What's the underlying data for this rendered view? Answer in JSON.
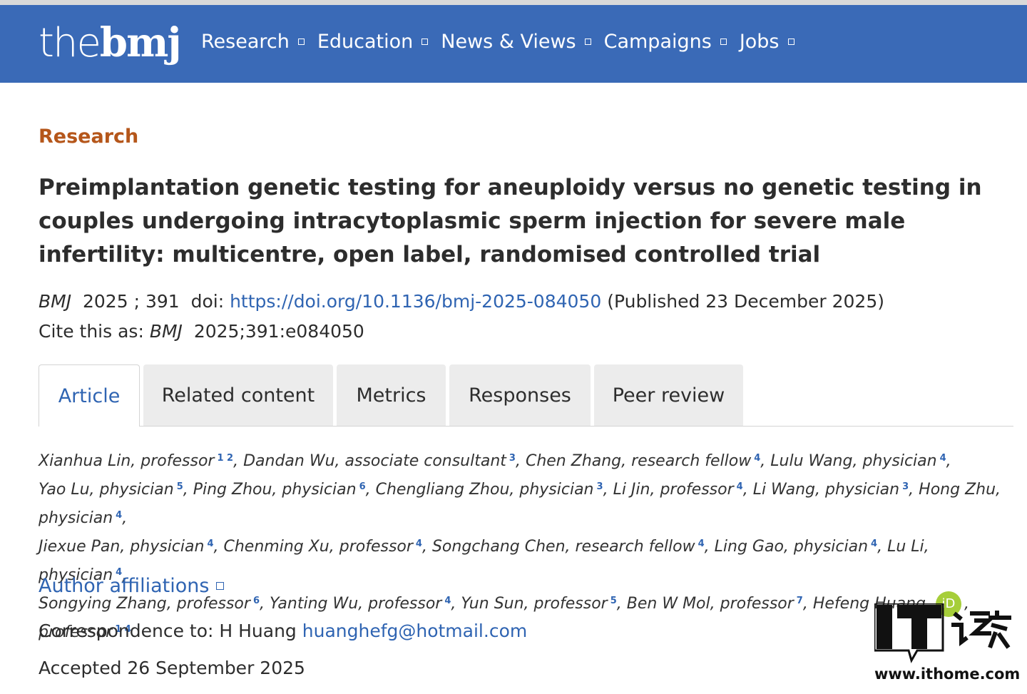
{
  "logo": {
    "thin": "the",
    "bold": "bmj"
  },
  "nav": {
    "items": [
      {
        "label": "Research"
      },
      {
        "label": "Education"
      },
      {
        "label": "News & Views"
      },
      {
        "label": "Campaigns"
      },
      {
        "label": "Jobs"
      }
    ]
  },
  "article": {
    "section": "Research",
    "title": "Preimplantation genetic testing for aneuploidy versus no genetic testing in couples undergoing intracytoplasmic sperm injection for severe male infertility: multicentre, open label, randomised controlled trial",
    "journal": "BMJ",
    "year_vol": "2025 ; 391",
    "doi_prefix": "doi:",
    "doi": "https://doi.org/10.1136/bmj-2025-084050",
    "published": "(Published 23 December 2025)",
    "cite_prefix": "Cite this as:",
    "cite_rest": "2025;391:e084050"
  },
  "tabs": [
    {
      "label": "Article",
      "active": true
    },
    {
      "label": "Related content"
    },
    {
      "label": "Metrics"
    },
    {
      "label": "Responses"
    },
    {
      "label": "Peer review"
    }
  ],
  "authors": [
    {
      "name": "Xianhua Lin, professor",
      "aff": "1  2"
    },
    {
      "name": "Dandan Wu, associate consultant",
      "aff": "3"
    },
    {
      "name": "Chen Zhang, research fellow",
      "aff": "4"
    },
    {
      "name": "Lulu Wang, physician",
      "aff": "4"
    },
    {
      "name": "Yao Lu, physician",
      "aff": "5"
    },
    {
      "name": "Ping Zhou, physician",
      "aff": "6"
    },
    {
      "name": "Chengliang Zhou, physician",
      "aff": "3"
    },
    {
      "name": "Li Jin, professor",
      "aff": "4"
    },
    {
      "name": "Li Wang, physician",
      "aff": "3"
    },
    {
      "name": "Hong Zhu, physician",
      "aff": "4"
    },
    {
      "name": "Jiexue Pan, physician",
      "aff": "4"
    },
    {
      "name": "Chenming Xu, professor",
      "aff": "4"
    },
    {
      "name": "Songchang Chen, research fellow",
      "aff": "4"
    },
    {
      "name": "Ling Gao, physician",
      "aff": "4"
    },
    {
      "name": "Lu Li, physician",
      "aff": "4"
    },
    {
      "name": "Songying Zhang, professor",
      "aff": "6"
    },
    {
      "name": "Yanting Wu, professor",
      "aff": "4"
    },
    {
      "name": "Yun Sun, professor",
      "aff": "5"
    },
    {
      "name": "Ben W Mol, professor",
      "aff": "7"
    },
    {
      "name": "Hefeng Huang",
      "orcid": "iD",
      "suffix": ", professor",
      "aff": "1  4"
    }
  ],
  "affiliations_label": "Author affiliations",
  "correspondence": {
    "prefix": "Correspondence to: H Huang",
    "email": "huanghefg@hotmail.com"
  },
  "accepted": "Accepted 26 September 2025",
  "watermark": {
    "text": "www.ithome.com",
    "logo_letters": "IT",
    "logo_chars": "之家"
  },
  "colors": {
    "navbar": "#3a6ab7",
    "section": "#b5561a",
    "link": "#2f64b2",
    "orcid": "#a6ce39"
  }
}
